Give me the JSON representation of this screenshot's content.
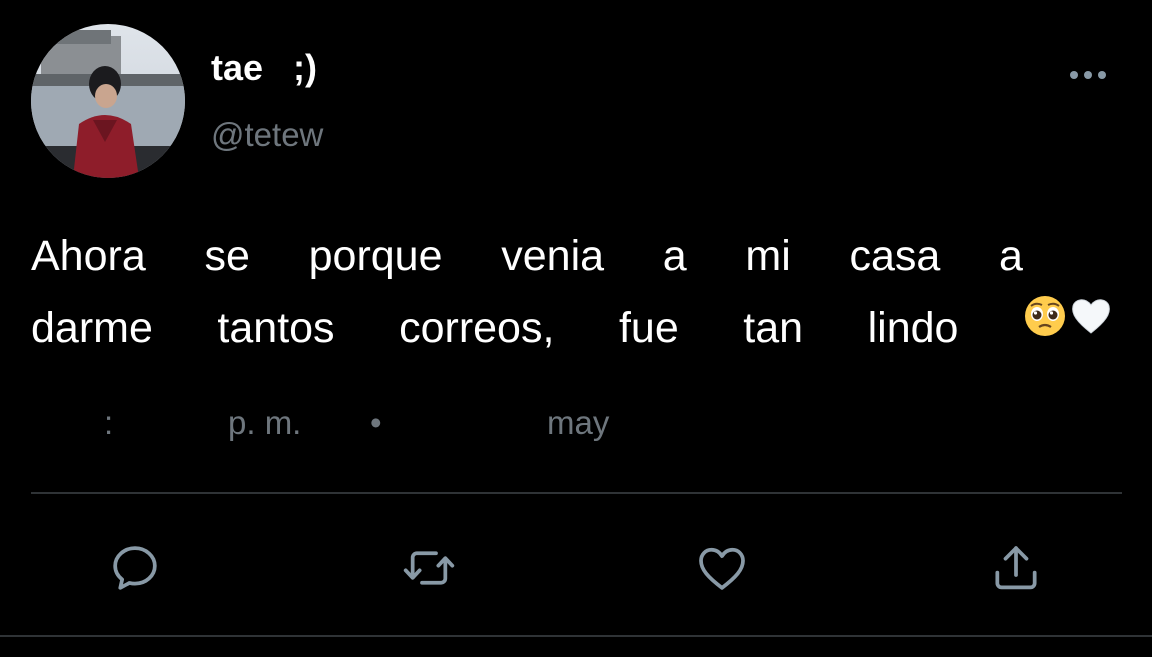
{
  "user": {
    "display_name": "tae   ;)",
    "handle": "@tetew"
  },
  "tweet": {
    "line1": [
      "Ahora",
      "se",
      "porque",
      "venia",
      "a",
      "mi",
      "casa",
      "a"
    ],
    "line2": [
      "darme",
      "tantos",
      "correos,",
      "fue",
      "tan",
      "lindo"
    ],
    "emojis": [
      "pleading-face-emoji",
      "white-heart-emoji"
    ]
  },
  "meta": {
    "time_separator": ":",
    "ampm": "p. m.",
    "bullet": "•",
    "month": "may"
  },
  "actions": [
    "reply-icon",
    "retweet-icon",
    "like-icon",
    "share-icon"
  ],
  "colors": {
    "background": "#000000",
    "text": "#ffffff",
    "secondary": "#6e767d",
    "divider": "#2f3336",
    "icon": "#8899a6"
  }
}
